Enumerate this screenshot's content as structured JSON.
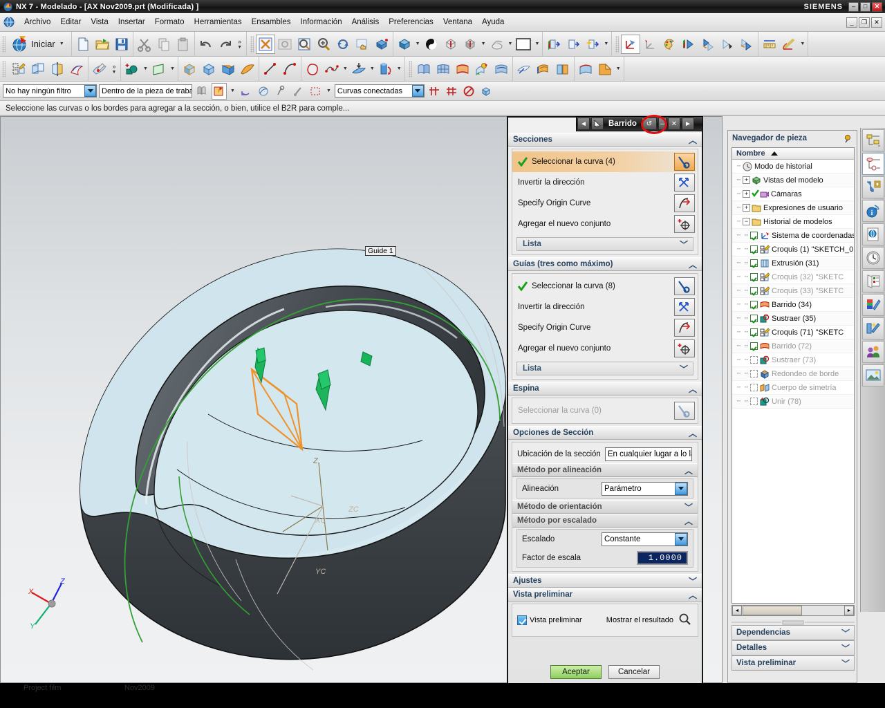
{
  "window": {
    "title": "NX 7 - Modelado - [AX Nov2009.prt (Modificada) ]",
    "brand": "SIEMENS",
    "minimize": "–",
    "maximize": "□",
    "close": "✕",
    "mdi_minimize": "_",
    "mdi_restore": "❐",
    "mdi_close": "✕"
  },
  "menubar": {
    "items": [
      {
        "label": "Archivo",
        "name": "menu-archivo"
      },
      {
        "label": "Editar",
        "name": "menu-editar"
      },
      {
        "label": "Vista",
        "name": "menu-vista"
      },
      {
        "label": "Insertar",
        "name": "menu-insertar"
      },
      {
        "label": "Formato",
        "name": "menu-formato"
      },
      {
        "label": "Herramientas",
        "name": "menu-herramientas"
      },
      {
        "label": "Ensambles",
        "name": "menu-ensambles"
      },
      {
        "label": "Información",
        "name": "menu-informacion"
      },
      {
        "label": "Análisis",
        "name": "menu-analisis"
      },
      {
        "label": "Preferencias",
        "name": "menu-preferencias"
      },
      {
        "label": "Ventana",
        "name": "menu-ventana"
      },
      {
        "label": "Ayuda",
        "name": "menu-ayuda"
      }
    ]
  },
  "toolbar_standard": {
    "start_label": "Iniciar",
    "icons": [
      "new-document-icon",
      "open-folder-icon",
      "save-icon",
      "cut-scissors-icon",
      "copy-icon",
      "paste-icon",
      "undo-icon",
      "redo-icon"
    ],
    "overflow": "»"
  },
  "toolbar_view": {
    "icons": [
      "fit-view-icon",
      "zoom-window-icon",
      "zoom-magnifier-icon",
      "zoom-in-out-icon",
      "rotate-icon",
      "pan-hand-icon",
      "perspective-box-icon",
      "shaded-box-icon",
      "shading-style-icon",
      "wireframe-box-icon",
      "studio-box-icon",
      "section-view-icon",
      "white-background-icon",
      "front-view-icon",
      "back-view-icon",
      "new-view-icon",
      "wcs-dynamic-icon",
      "wcs-origin-icon",
      "color-palette-icon",
      "layer-visible-icon",
      "layer-settings-icon",
      "move-to-layer-icon",
      "copy-to-layer-icon",
      "measure-distance-icon",
      "measure-angle-icon"
    ]
  },
  "toolbar_feature": {
    "icons": [
      "sketch-in-task-icon",
      "datum-plane-icon",
      "datum-axis-icon",
      "sketch-curve-icon",
      "sketch-on-path-icon",
      "extrude-icon",
      "revolve-icon",
      "block-icon",
      "sphere-icon",
      "cylinder-icon",
      "cone-icon",
      "line-icon",
      "arc-icon",
      "profile-icon",
      "spline-icon",
      "offset-curve-icon",
      "tube-icon",
      "ruled-surface-icon",
      "through-curves-icon",
      "swept-icon",
      "studio-surface-icon",
      "offset-surface-icon",
      "trim-sheet-icon",
      "thicken-icon",
      "sew-icon",
      "edge-blend-icon",
      "chamfer-icon"
    ]
  },
  "selection_bar": {
    "filter_value": "No hay ningún filtro",
    "scope_value": "Dentro de la pieza de trabajo",
    "curve_rule_value": "Curvas conectadas",
    "icons": [
      "find-object-icon",
      "select-general-icon",
      "snap-point-toggle-icon",
      "snap-disable-icon",
      "snap-point-icon",
      "snap-curve-icon",
      "rectangle-select-icon",
      "stop-at-intersection-icon",
      "follow-fillet-icon",
      "chain-within-feature-icon",
      "snap-off-icon",
      "render-style-icon"
    ]
  },
  "cue_line": {
    "text": "Seleccione las curvas o los bordes para agregar a la sección, o bien, utilice el B2R para comple..."
  },
  "graphics": {
    "guide_label": "Guide 1",
    "triad_x": "X",
    "triad_y": "Y",
    "triad_z": "Z",
    "wcs_z": "Z",
    "wcs_zc": "ZC",
    "wcs_xc": "XC",
    "wcs_yc": "YC",
    "colors": {
      "body_top": "#cfe4ec",
      "body_dark": "#4b5156",
      "guide_curve": "#3ea13e",
      "section_curve": "#f08a2a",
      "vector_arrow": "#17b35c"
    }
  },
  "dialog": {
    "title": "Barrido",
    "nav_prev": "◄",
    "nav_next": "►",
    "pointer_icon": "arrow-cursor-icon",
    "reset_icon": "reset-icon",
    "reset_glyph": "↺",
    "minimize_glyph": "–",
    "close_glyph": "✕",
    "sections": {
      "header": "Secciones",
      "chevron": "︿",
      "select_curve": "Seleccionar la curva (4)",
      "invert_direction": "Invertir la dirección",
      "specify_origin_curve": "Specify Origin Curve",
      "add_new_set": "Agregar el nuevo conjunto",
      "list": "Lista",
      "list_chevron": "﹀"
    },
    "guides": {
      "header": "Guías (tres como máximo)",
      "chevron": "︿",
      "select_curve": "Seleccionar la curva (8)",
      "invert_direction": "Invertir la dirección",
      "specify_origin_curve": "Specify Origin Curve",
      "add_new_set": "Agregar el nuevo conjunto",
      "list": "Lista",
      "list_chevron": "﹀"
    },
    "spine": {
      "header": "Espina",
      "chevron": "︿",
      "select_curve": "Seleccionar la curva (0)"
    },
    "section_options": {
      "header": "Opciones de Sección",
      "chevron": "︿",
      "location_label": "Ubicación de la sección",
      "location_value": "En cualquier lugar a lo largo de la guía",
      "alignment_group": "Método por alineación",
      "alignment_group_chevron": "︿",
      "alignment_label": "Alineación",
      "alignment_value": "Parámetro",
      "orientation_group": "Método de orientación",
      "orientation_group_chevron": "﹀",
      "scaling_group": "Método por escalado",
      "scaling_group_chevron": "︿",
      "scaling_label": "Escalado",
      "scaling_value": "Constante",
      "scale_factor_label": "Factor de escala",
      "scale_factor_value": "1.0000"
    },
    "settings": {
      "header": "Ajustes",
      "chevron": "﹀"
    },
    "preview": {
      "header": "Vista preliminar",
      "chevron": "︿",
      "checkbox_label": "Vista preliminar",
      "show_result_label": "Mostrar el resultado",
      "show_result_icon": "magnifier-icon"
    },
    "buttons": {
      "ok": "Aceptar",
      "cancel": "Cancelar"
    }
  },
  "navigator": {
    "title": "Navegador de pieza",
    "pin_icon": "pin-icon",
    "column_header": "Nombre",
    "tree": [
      {
        "label": "Modo de historial",
        "icon": "clock-icon",
        "indent": 0,
        "expander": "",
        "check": "none",
        "dim": false
      },
      {
        "label": "Vistas del modelo",
        "icon": "model-views-icon",
        "indent": 0,
        "expander": "+",
        "check": "none",
        "dim": false
      },
      {
        "label": "Cámaras",
        "icon": "camera-icon",
        "indent": 0,
        "expander": "+",
        "check": "green",
        "dim": false
      },
      {
        "label": "Expresiones de usuario",
        "icon": "folder-icon",
        "indent": 0,
        "expander": "+",
        "check": "none",
        "dim": false
      },
      {
        "label": "Historial de modelos",
        "icon": "folder-icon",
        "indent": 0,
        "expander": "−",
        "check": "none",
        "dim": false
      },
      {
        "label": "Sistema de coordenadas",
        "icon": "csys-icon",
        "indent": 1,
        "expander": "",
        "check": "on",
        "dim": false
      },
      {
        "label": "Croquis (1) \"SKETCH_0",
        "icon": "sketch-icon",
        "indent": 1,
        "expander": "",
        "check": "on",
        "dim": false
      },
      {
        "label": "Extrusión (31)",
        "icon": "extrude-icon",
        "indent": 1,
        "expander": "",
        "check": "on",
        "dim": false
      },
      {
        "label": "Croquis (32) \"SKETC",
        "icon": "sketch-icon",
        "indent": 1,
        "expander": "",
        "check": "on",
        "dim": true
      },
      {
        "label": "Croquis (33) \"SKETC",
        "icon": "sketch-icon",
        "indent": 1,
        "expander": "",
        "check": "on",
        "dim": true
      },
      {
        "label": "Barrido (34)",
        "icon": "swept-icon",
        "indent": 1,
        "expander": "",
        "check": "on",
        "dim": false
      },
      {
        "label": "Sustraer (35)",
        "icon": "subtract-icon",
        "indent": 1,
        "expander": "",
        "check": "on",
        "dim": false
      },
      {
        "label": "Croquis (71) \"SKETC",
        "icon": "sketch-icon",
        "indent": 1,
        "expander": "",
        "check": "on",
        "dim": false
      },
      {
        "label": "Barrido (72)",
        "icon": "swept-icon",
        "indent": 1,
        "expander": "",
        "check": "on",
        "dim": true
      },
      {
        "label": "Sustraer (73)",
        "icon": "subtract-icon",
        "indent": 1,
        "expander": "",
        "check": "off",
        "dim": true
      },
      {
        "label": "Redondeo de borde",
        "icon": "blend-icon",
        "indent": 1,
        "expander": "",
        "check": "off",
        "dim": true
      },
      {
        "label": "Cuerpo de simetría",
        "icon": "mirror-icon",
        "indent": 1,
        "expander": "",
        "check": "off",
        "dim": true
      },
      {
        "label": "Unir (78)",
        "icon": "unite-icon",
        "indent": 1,
        "expander": "",
        "check": "off",
        "dim": true
      }
    ],
    "scroll_left": "◄",
    "scroll_right": "►",
    "sections": [
      {
        "label": "Dependencias",
        "chevron": "﹀",
        "name": "navigator-section-dependencias"
      },
      {
        "label": "Detalles",
        "chevron": "﹀",
        "name": "navigator-section-detalles"
      },
      {
        "label": "Vista preliminar",
        "chevron": "﹀",
        "name": "navigator-section-vista-preliminar"
      }
    ]
  },
  "resource_rail": {
    "items": [
      {
        "name": "assembly-navigator-icon",
        "selected": false
      },
      {
        "name": "constraint-navigator-icon",
        "selected": true
      },
      {
        "name": "part-navigator-icon",
        "selected": false
      },
      {
        "name": "help-info-icon",
        "selected": false
      },
      {
        "name": "web-browser-icon",
        "selected": false
      },
      {
        "name": "history-clock-icon",
        "selected": false
      },
      {
        "name": "roles-icon",
        "selected": false
      },
      {
        "name": "system-materials-icon",
        "selected": false
      },
      {
        "name": "system-scenes-icon",
        "selected": false
      },
      {
        "name": "system-visual-icon",
        "selected": false
      },
      {
        "name": "palette-image-icon",
        "selected": false
      }
    ]
  },
  "taskbar": {
    "label1": "Project film",
    "label2": "Nov2009"
  }
}
